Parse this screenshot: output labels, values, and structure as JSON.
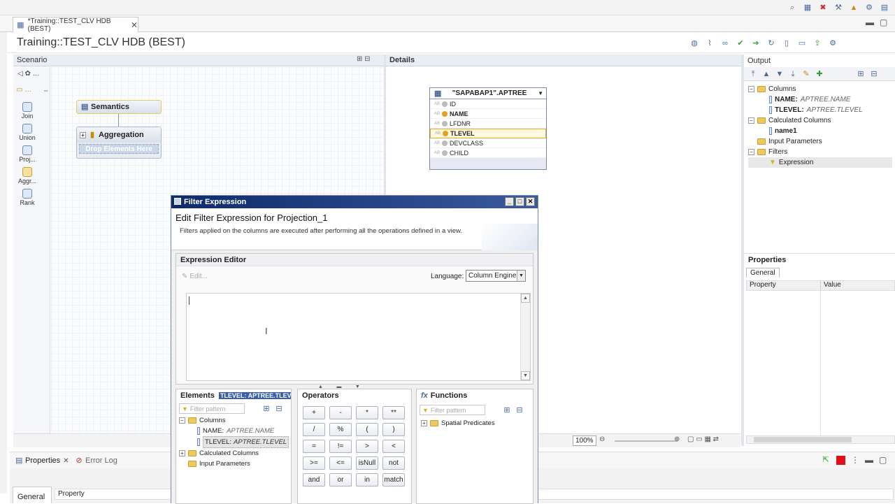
{
  "editor_tab": {
    "label": "*Training::TEST_CLV HDB (BEST)"
  },
  "page": {
    "title": "Training::TEST_CLV HDB (BEST)"
  },
  "scenario": {
    "title": "Scenario",
    "palette": [
      {
        "label": "Join",
        "icon": "join-icon"
      },
      {
        "label": "Union",
        "icon": "union-icon"
      },
      {
        "label": "Proj...",
        "icon": "projection-icon"
      },
      {
        "label": "Aggr...",
        "icon": "aggregation-icon"
      },
      {
        "label": "Rank",
        "icon": "rank-icon"
      }
    ],
    "nodes": {
      "semantics": "Semantics",
      "aggregation": "Aggregation",
      "drop_hint": "Drop Elements Here"
    },
    "zoom": "100%"
  },
  "details": {
    "title": "Details",
    "table": {
      "name": "\"SAPABAP1\".APTREE",
      "columns": [
        {
          "name": "ID",
          "bold": false,
          "key": false
        },
        {
          "name": "NAME",
          "bold": true,
          "key": true
        },
        {
          "name": "LFDNR",
          "bold": false,
          "key": false
        },
        {
          "name": "TLEVEL",
          "bold": true,
          "key": true
        },
        {
          "name": "DEVCLASS",
          "bold": false,
          "key": false
        },
        {
          "name": "CHILD",
          "bold": false,
          "key": false
        }
      ]
    }
  },
  "output": {
    "title": "Output",
    "tree": {
      "columns": "Columns",
      "col1_name": "NAME:",
      "col1_src": "APTREE.NAME",
      "col2_name": "TLEVEL:",
      "col2_src": "APTREE.TLEVEL",
      "calc": "Calculated Columns",
      "calc1": "name1",
      "input_params": "Input Parameters",
      "filters": "Filters",
      "expression": "Expression"
    }
  },
  "properties": {
    "title": "Properties",
    "tab": "General",
    "col_property": "Property",
    "col_value": "Value"
  },
  "bottom": {
    "properties_tab": "Properties",
    "error_log_tab": "Error Log",
    "general_tab": "General",
    "property_col": "Property"
  },
  "dialog": {
    "window_title": "Filter Expression",
    "heading": "Edit Filter Expression for Projection_1",
    "description": "Filters applied on the columns are executed after performing all the operations defined in a view.",
    "expr_editor": "Expression Editor",
    "edit": "Edit...",
    "language_label": "Language:",
    "language_value": "Column Engine",
    "elements": {
      "title": "Elements",
      "selected_chip": "TLEVEL: APTREE.TLEVEL",
      "filter_placeholder": "Filter pattern",
      "columns": "Columns",
      "col1_name": "NAME:",
      "col1_src": "APTREE.NAME",
      "col2_name": "TLEVEL:",
      "col2_src": "APTREE.TLEVEL",
      "calc": "Calculated Columns",
      "input_params": "Input Parameters"
    },
    "operators": {
      "title": "Operators",
      "buttons": [
        "+",
        "-",
        "*",
        "**",
        "/",
        "%",
        "(",
        ")",
        "=",
        "!=",
        ">",
        "<",
        ">=",
        "<=",
        "isNull",
        "not",
        "and",
        "or",
        "in",
        "match"
      ]
    },
    "functions": {
      "title": "Functions",
      "filter_placeholder": "Filter pattern",
      "items": [
        "Spatial Predicates"
      ]
    }
  }
}
